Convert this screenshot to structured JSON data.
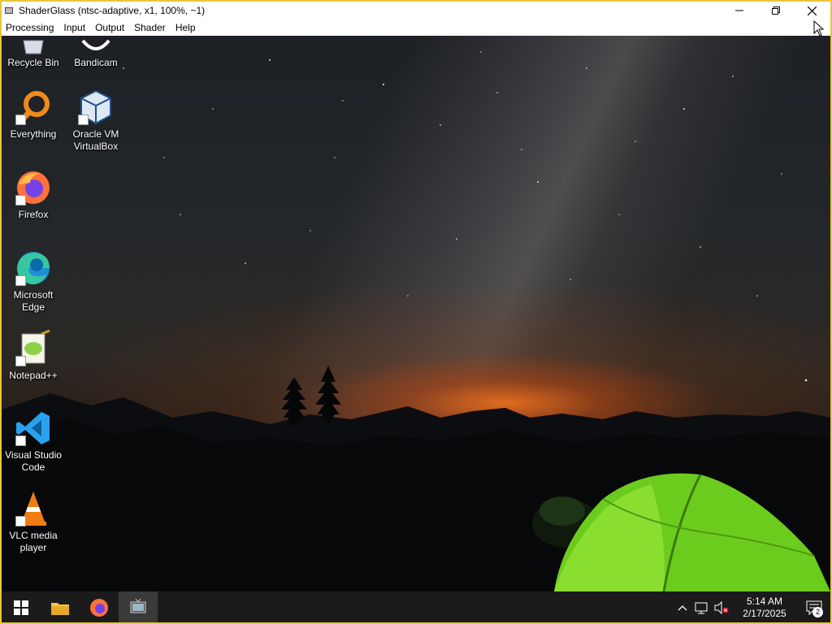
{
  "window": {
    "title": "ShaderGlass (ntsc-adaptive, x1, 100%, ~1)",
    "menu": [
      "Processing",
      "Input",
      "Output",
      "Shader",
      "Help"
    ]
  },
  "desktop": {
    "icons": [
      {
        "label": "Recycle Bin",
        "icon": "recycle-bin-icon"
      },
      {
        "label": "Bandicam",
        "icon": "bandicam-icon"
      },
      {
        "label": "Everything",
        "icon": "everything-icon"
      },
      {
        "label": "Oracle VM VirtualBox",
        "icon": "virtualbox-icon"
      },
      {
        "label": "Firefox",
        "icon": "firefox-icon"
      },
      {
        "label": "Microsoft Edge",
        "icon": "edge-icon"
      },
      {
        "label": "Notepad++",
        "icon": "notepadpp-icon"
      },
      {
        "label": "Visual Studio Code",
        "icon": "vscode-icon"
      },
      {
        "label": "VLC media player",
        "icon": "vlc-icon"
      }
    ]
  },
  "taskbar": {
    "pinned": [
      "start-icon",
      "file-explorer-icon",
      "firefox-icon",
      "shaderglass-icon"
    ],
    "clock": {
      "time": "5:14 AM",
      "date": "2/17/2025"
    },
    "notification_count": "2"
  },
  "colors": {
    "frame": "#e7c63a",
    "taskbar": "#1b1b1b",
    "accent": "#76b9ed"
  }
}
